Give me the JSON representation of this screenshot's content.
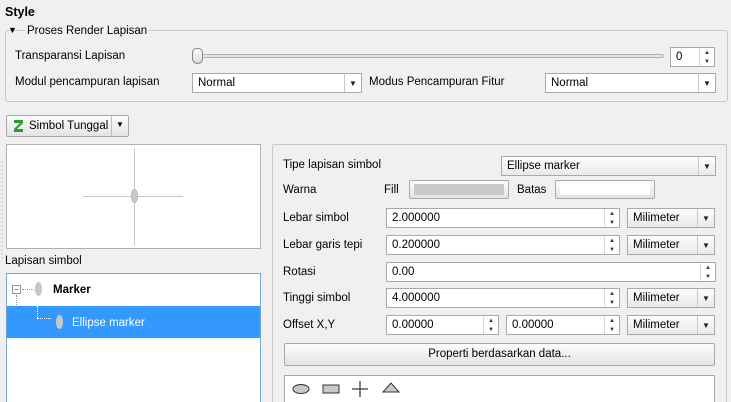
{
  "section_title": "Style",
  "render_group": {
    "title": "Proses Render Lapisan",
    "transparency_label": "Transparansi Lapisan",
    "transparency_value": "0",
    "transparency_level": 0,
    "blend_layer_label": "Modul pencampuran lapisan",
    "blend_layer_value": "Normal",
    "blend_feature_label": "Modus Pencampuran Fitur",
    "blend_feature_value": "Normal"
  },
  "renderer": {
    "label": "Simbol Tunggal"
  },
  "symbol_layers": {
    "label": "Lapisan simbol",
    "items": [
      {
        "label": "Marker"
      },
      {
        "label": "Ellipse marker"
      }
    ]
  },
  "properties": {
    "layer_type_label": "Tipe lapisan simbol",
    "layer_type_value": "Ellipse marker",
    "color_label": "Warna",
    "fill_label": "Fill",
    "stroke_label": "Batas",
    "fill_color": "#c8c8c8",
    "stroke_color": "#ffffff",
    "width_label": "Lebar simbol",
    "width_value": "2.000000",
    "width_unit": "Milimeter",
    "stroke_width_label": "Lebar garis tepi",
    "stroke_width_value": "0.200000",
    "stroke_width_unit": "Milimeter",
    "rotation_label": "Rotasi",
    "rotation_value": "0.00",
    "height_label": "Tinggi simbol",
    "height_value": "4.000000",
    "height_unit": "Milimeter",
    "offset_label": "Offset X,Y",
    "offset_x": "0.00000",
    "offset_y": "0.00000",
    "offset_unit": "Milimeter",
    "data_defined_button": "Properti berdasarkan data..."
  },
  "shape_icons": [
    "ellipse-icon",
    "rectangle-icon",
    "cross-icon",
    "triangle-icon"
  ]
}
